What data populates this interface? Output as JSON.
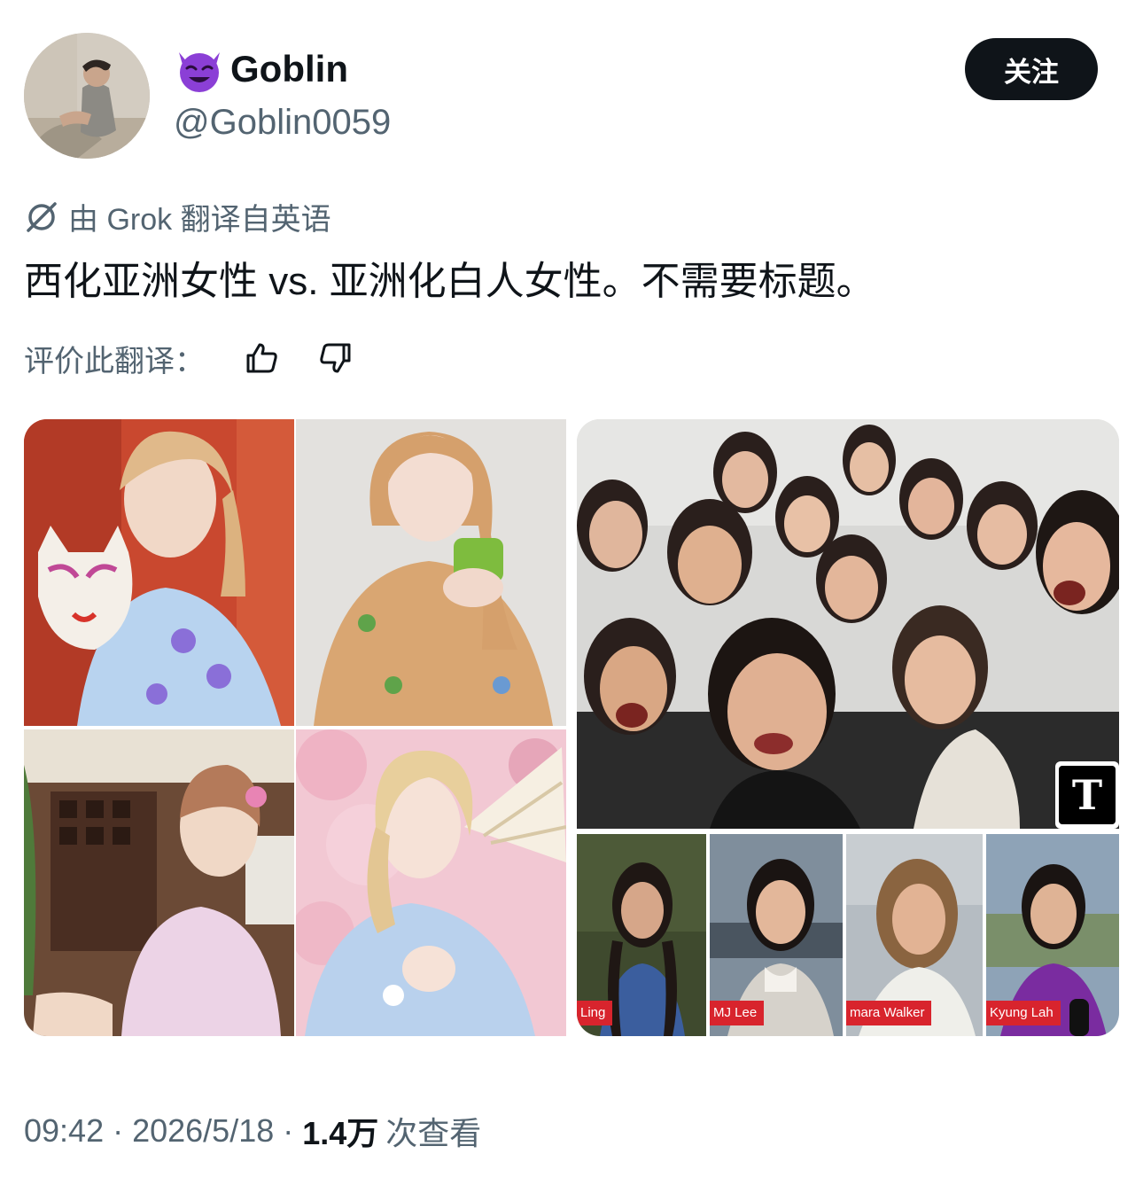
{
  "author": {
    "name": "Goblin",
    "handle": "@Goblin0059",
    "emoji_icon": "smiling-devil-icon",
    "follow_label": "关注"
  },
  "translation": {
    "notice": "由 Grok 翻译自英语",
    "icon": "grok-icon",
    "text": "西化亚洲女性 vs. 亚洲化白人女性。不需要标题。",
    "rate_label": "评价此翻译："
  },
  "media": {
    "left_grid_photos": 4,
    "right_panel": {
      "logo_letter": "T",
      "news_captions": [
        "Ling",
        "MJ Lee",
        "mara Walker",
        "Kyung Lah"
      ]
    }
  },
  "meta": {
    "time": "09:42",
    "date": "2026/5/18",
    "separator": "·",
    "views_count": "1.4万",
    "views_label": "次查看"
  },
  "colors": {
    "text_primary": "#0f1419",
    "text_secondary": "#536471",
    "button_bg": "#0f1419",
    "news_red": "#d8242d"
  }
}
